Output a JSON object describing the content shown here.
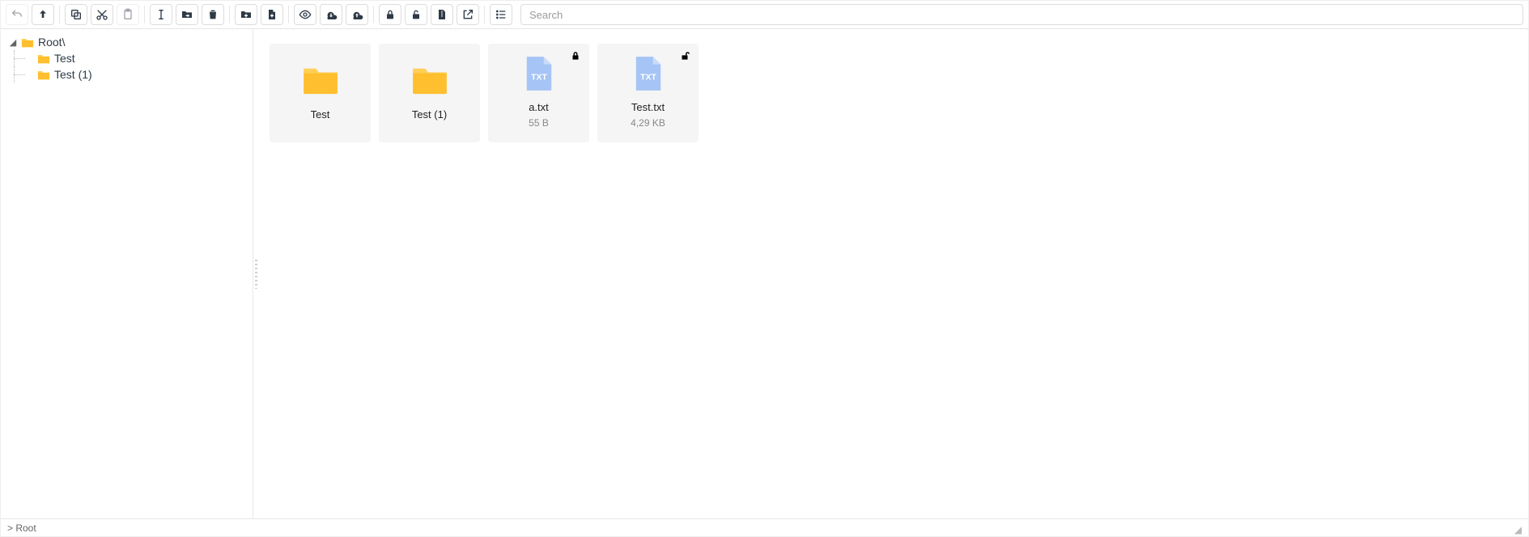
{
  "toolbar": {
    "search_placeholder": "Search"
  },
  "tree": {
    "root": {
      "label": "Root\\"
    },
    "child0": {
      "label": "Test"
    },
    "child1": {
      "label": "Test (1)"
    }
  },
  "tiles": {
    "0": {
      "name": "Test"
    },
    "1": {
      "name": "Test (1)"
    },
    "2": {
      "name": "a.txt",
      "meta": "55 B",
      "locked": true
    },
    "3": {
      "name": "Test.txt",
      "meta": "4,29 KB",
      "locked": false
    }
  },
  "status": {
    "breadcrumb": "> Root"
  },
  "icons": {
    "undo": "undo-icon",
    "up": "go-up-icon",
    "copy": "copy-icon",
    "cut": "scissors-icon",
    "paste": "paste-icon",
    "rename": "cursor-text-icon",
    "move": "folder-move-icon",
    "delete": "trash-icon",
    "newfolder": "folder-plus-icon",
    "newfile": "file-plus-icon",
    "preview": "eye-icon",
    "download": "cloud-download-icon",
    "upload": "cloud-upload-icon",
    "lock": "lock-icon",
    "unlock": "unlock-icon",
    "compress": "file-archive-icon",
    "open": "external-link-icon",
    "list": "list-view-icon"
  }
}
